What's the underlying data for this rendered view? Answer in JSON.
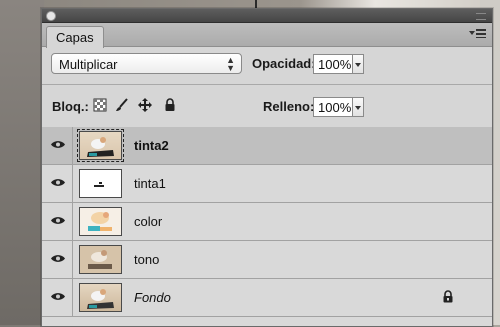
{
  "panel": {
    "tab_label": "Capas",
    "blend_mode": "Multiplicar",
    "opacity_label": "Opacidad:",
    "opacity_value": "100%",
    "lock_label": "Bloq.:",
    "fill_label": "Relleno:",
    "fill_value": "100%"
  },
  "layers": [
    {
      "name": "tinta2",
      "selected": true,
      "visible": true,
      "bold": true
    },
    {
      "name": "tinta1",
      "selected": false,
      "visible": true
    },
    {
      "name": "color",
      "selected": false,
      "visible": true
    },
    {
      "name": "tono",
      "selected": false,
      "visible": true
    },
    {
      "name": "Fondo",
      "selected": false,
      "visible": true,
      "italic": true,
      "locked": true
    }
  ],
  "colors": {
    "panel_bg": "#d6d6d6",
    "selected_row": "#bfbfbf"
  },
  "icons": [
    "visibility-eye-icon",
    "lock-transparent-pixels-icon",
    "lock-image-pixels-icon",
    "lock-position-icon",
    "lock-all-icon",
    "panel-menu-icon"
  ]
}
